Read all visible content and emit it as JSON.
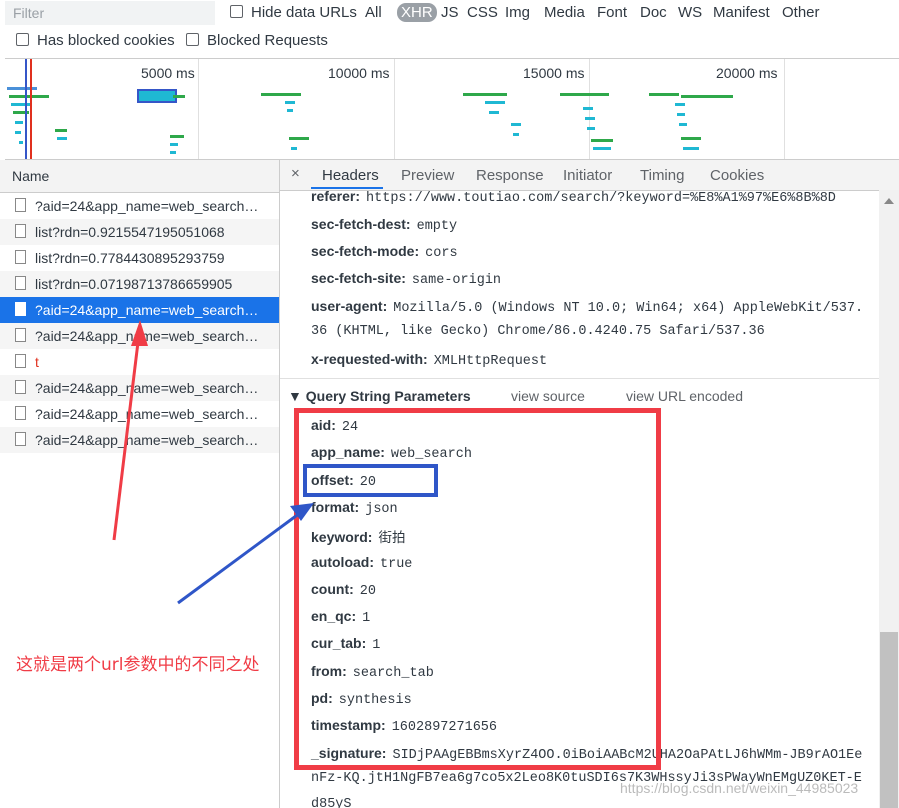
{
  "filter": {
    "placeholder": "Filter",
    "hide_data_urls": "Hide data URLs",
    "types": [
      "All",
      "XHR",
      "JS",
      "CSS",
      "Img",
      "Media",
      "Font",
      "Doc",
      "WS",
      "Manifest",
      "Other"
    ],
    "active_type": "XHR",
    "has_blocked_cookies": "Has blocked cookies",
    "blocked_requests": "Blocked Requests"
  },
  "overview": {
    "ticks": [
      "5000 ms",
      "10000 ms",
      "15000 ms",
      "20000 ms"
    ]
  },
  "requests": {
    "header": "Name",
    "rows": [
      {
        "name": "?aid=24&app_name=web_search…",
        "state": "normal"
      },
      {
        "name": "list?rdn=0.9215547195051068",
        "state": "normal"
      },
      {
        "name": "list?rdn=0.7784430895293759",
        "state": "normal"
      },
      {
        "name": "list?rdn=0.07198713786659905",
        "state": "normal"
      },
      {
        "name": "?aid=24&app_name=web_search…",
        "state": "selected"
      },
      {
        "name": "?aid=24&app_name=web_search…",
        "state": "normal"
      },
      {
        "name": "t",
        "state": "error"
      },
      {
        "name": "?aid=24&app_name=web_search…",
        "state": "normal"
      },
      {
        "name": "?aid=24&app_name=web_search…",
        "state": "normal"
      },
      {
        "name": "?aid=24&app_name=web_search…",
        "state": "normal"
      }
    ]
  },
  "detail": {
    "close": "×",
    "tabs": [
      "Headers",
      "Preview",
      "Response",
      "Initiator",
      "Timing",
      "Cookies"
    ],
    "active_tab": "Headers",
    "request_headers": [
      {
        "key": "referer:",
        "value": "https://www.toutiao.com/search/?keyword=%E8%A1%97%E6%8B%8D"
      },
      {
        "key": "sec-fetch-dest:",
        "value": "empty"
      },
      {
        "key": "sec-fetch-mode:",
        "value": "cors"
      },
      {
        "key": "sec-fetch-site:",
        "value": "same-origin"
      },
      {
        "key": "user-agent:",
        "value": "Mozilla/5.0 (Windows NT 10.0; Win64; x64) AppleWebKit/537.",
        "cont": "36 (KHTML, like Gecko) Chrome/86.0.4240.75 Safari/537.36"
      },
      {
        "key": "x-requested-with:",
        "value": "XMLHttpRequest"
      }
    ],
    "query_section": {
      "title": "▼ Query String Parameters",
      "view_source": "view source",
      "view_url_encoded": "view URL encoded"
    },
    "query_params": [
      {
        "key": "aid:",
        "value": "24"
      },
      {
        "key": "app_name:",
        "value": "web_search"
      },
      {
        "key": "offset:",
        "value": "20"
      },
      {
        "key": "format:",
        "value": "json"
      },
      {
        "key": "keyword:",
        "value": "街拍"
      },
      {
        "key": "autoload:",
        "value": "true"
      },
      {
        "key": "count:",
        "value": "20"
      },
      {
        "key": "en_qc:",
        "value": "1"
      },
      {
        "key": "cur_tab:",
        "value": "1"
      },
      {
        "key": "from:",
        "value": "search_tab"
      },
      {
        "key": "pd:",
        "value": "synthesis"
      },
      {
        "key": "timestamp:",
        "value": "1602897271656"
      },
      {
        "key": "_signature:",
        "value": "SIDjPAAgEBBmsXyrZ4OO.0iBoiAABcM2UHA2OaPAtLJ6hWMm-JB9rAO1Ee",
        "cont1": "nFz-KQ.jtH1NgFB7ea6g7co5x2Leo8K0tuSDI6s7K3WHssyJi3sPWayWnEMgUZ0KET-E",
        "cont2": "d85yS"
      }
    ]
  },
  "annotation": {
    "text": "这就是两个url参数中的不同之处",
    "red_color": "#f03c46",
    "blue_color": "#2f56c8"
  },
  "watermark": "https://blog.csdn.net/weixin_44985023"
}
